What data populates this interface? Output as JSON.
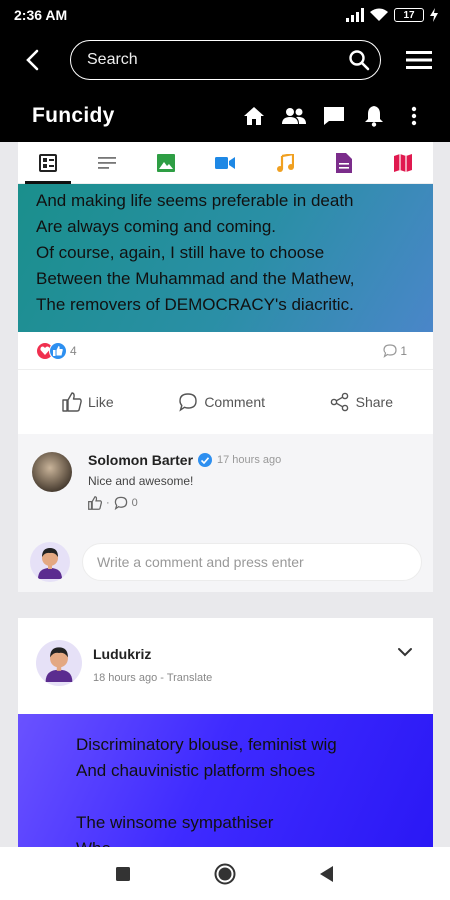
{
  "status": {
    "time": "2:36 AM",
    "battery": "17"
  },
  "header": {
    "search_placeholder": "Search",
    "brand": "Funcidy"
  },
  "post1": {
    "lines": [
      "And making life seems preferable in death",
      "Are always coming and coming.",
      "Of course, again, I still have to choose",
      "Between the Muhammad and the Mathew,",
      "The removers of DEMOCRACY's diacritic."
    ],
    "reactions_count": "4",
    "comments_count": "1",
    "actions": {
      "like": "Like",
      "comment": "Comment",
      "share": "Share"
    }
  },
  "comment": {
    "author": "Solomon Barter",
    "time": "17 hours ago",
    "text": "Nice and awesome!",
    "reply_count": "0"
  },
  "comment_input": {
    "placeholder": "Write a comment and press enter"
  },
  "post2": {
    "author": "Ludukriz",
    "time": "18 hours ago",
    "translate": "Translate",
    "lines": [
      "Discriminatory blouse, feminist wig",
      "And chauvinistic platform shoes",
      "",
      "The winsome sympathiser",
      "Whe..."
    ]
  },
  "colors": {
    "tab_green": "#2e9e44",
    "tab_blue": "#1e88e5",
    "tab_orange": "#f0a020",
    "tab_purple": "#7b2d8b",
    "tab_red": "#e0194f",
    "post1_gradient": [
      "#1a8f8c",
      "#4a86c9"
    ],
    "post2_gradient": [
      "#6a52ff",
      "#2a18f5"
    ]
  }
}
